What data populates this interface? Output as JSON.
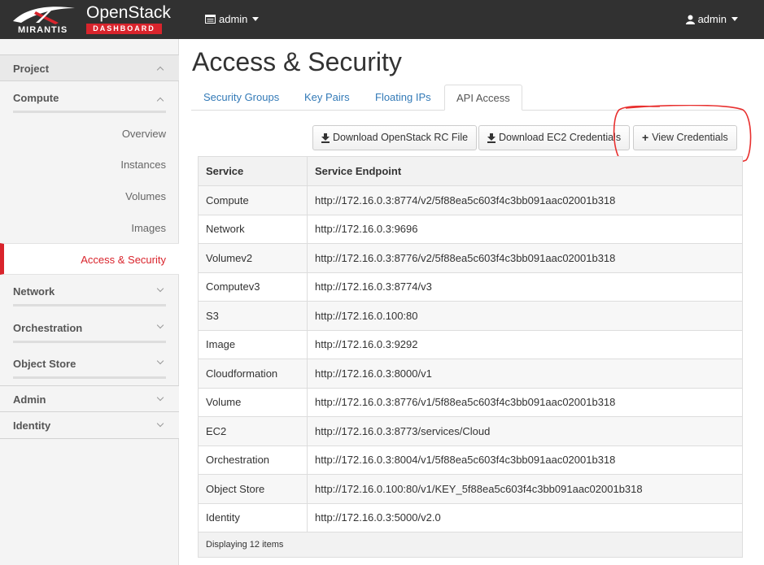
{
  "brand": {
    "company": "MIRANTIS",
    "product": "OpenStack",
    "subtitle": "DASHBOARD"
  },
  "topbar": {
    "project_label": "admin",
    "user_label": "admin"
  },
  "sidebar": {
    "project_header": "Project",
    "compute_group": "Compute",
    "compute_items": [
      "Overview",
      "Instances",
      "Volumes",
      "Images",
      "Access & Security"
    ],
    "active_item": "Access & Security",
    "network_group": "Network",
    "orchestration_group": "Orchestration",
    "object_store_group": "Object Store",
    "admin_header": "Admin",
    "identity_header": "Identity"
  },
  "page": {
    "title": "Access & Security"
  },
  "tabs": {
    "items": [
      "Security Groups",
      "Key Pairs",
      "Floating IPs",
      "API Access"
    ],
    "active": "API Access"
  },
  "actions": {
    "download_rc": "Download OpenStack RC File",
    "download_ec2": "Download EC2 Credentials",
    "view_credentials": "View Credentials"
  },
  "table": {
    "headers": [
      "Service",
      "Service Endpoint"
    ],
    "rows": [
      [
        "Compute",
        "http://172.16.0.3:8774/v2/5f88ea5c603f4c3bb091aac02001b318"
      ],
      [
        "Network",
        "http://172.16.0.3:9696"
      ],
      [
        "Volumev2",
        "http://172.16.0.3:8776/v2/5f88ea5c603f4c3bb091aac02001b318"
      ],
      [
        "Computev3",
        "http://172.16.0.3:8774/v3"
      ],
      [
        "S3",
        "http://172.16.0.100:80"
      ],
      [
        "Image",
        "http://172.16.0.3:9292"
      ],
      [
        "Cloudformation",
        "http://172.16.0.3:8000/v1"
      ],
      [
        "Volume",
        "http://172.16.0.3:8776/v1/5f88ea5c603f4c3bb091aac02001b318"
      ],
      [
        "EC2",
        "http://172.16.0.3:8773/services/Cloud"
      ],
      [
        "Orchestration",
        "http://172.16.0.3:8004/v1/5f88ea5c603f4c3bb091aac02001b318"
      ],
      [
        "Object Store",
        "http://172.16.0.100:80/v1/KEY_5f88ea5c603f4c3bb091aac02001b318"
      ],
      [
        "Identity",
        "http://172.16.0.3:5000/v2.0"
      ]
    ],
    "footer": "Displaying 12 items"
  },
  "colors": {
    "topbar": "#313131",
    "accent": "#d9242c",
    "link": "#337ab7",
    "highlight_circle": "#e8302f"
  }
}
